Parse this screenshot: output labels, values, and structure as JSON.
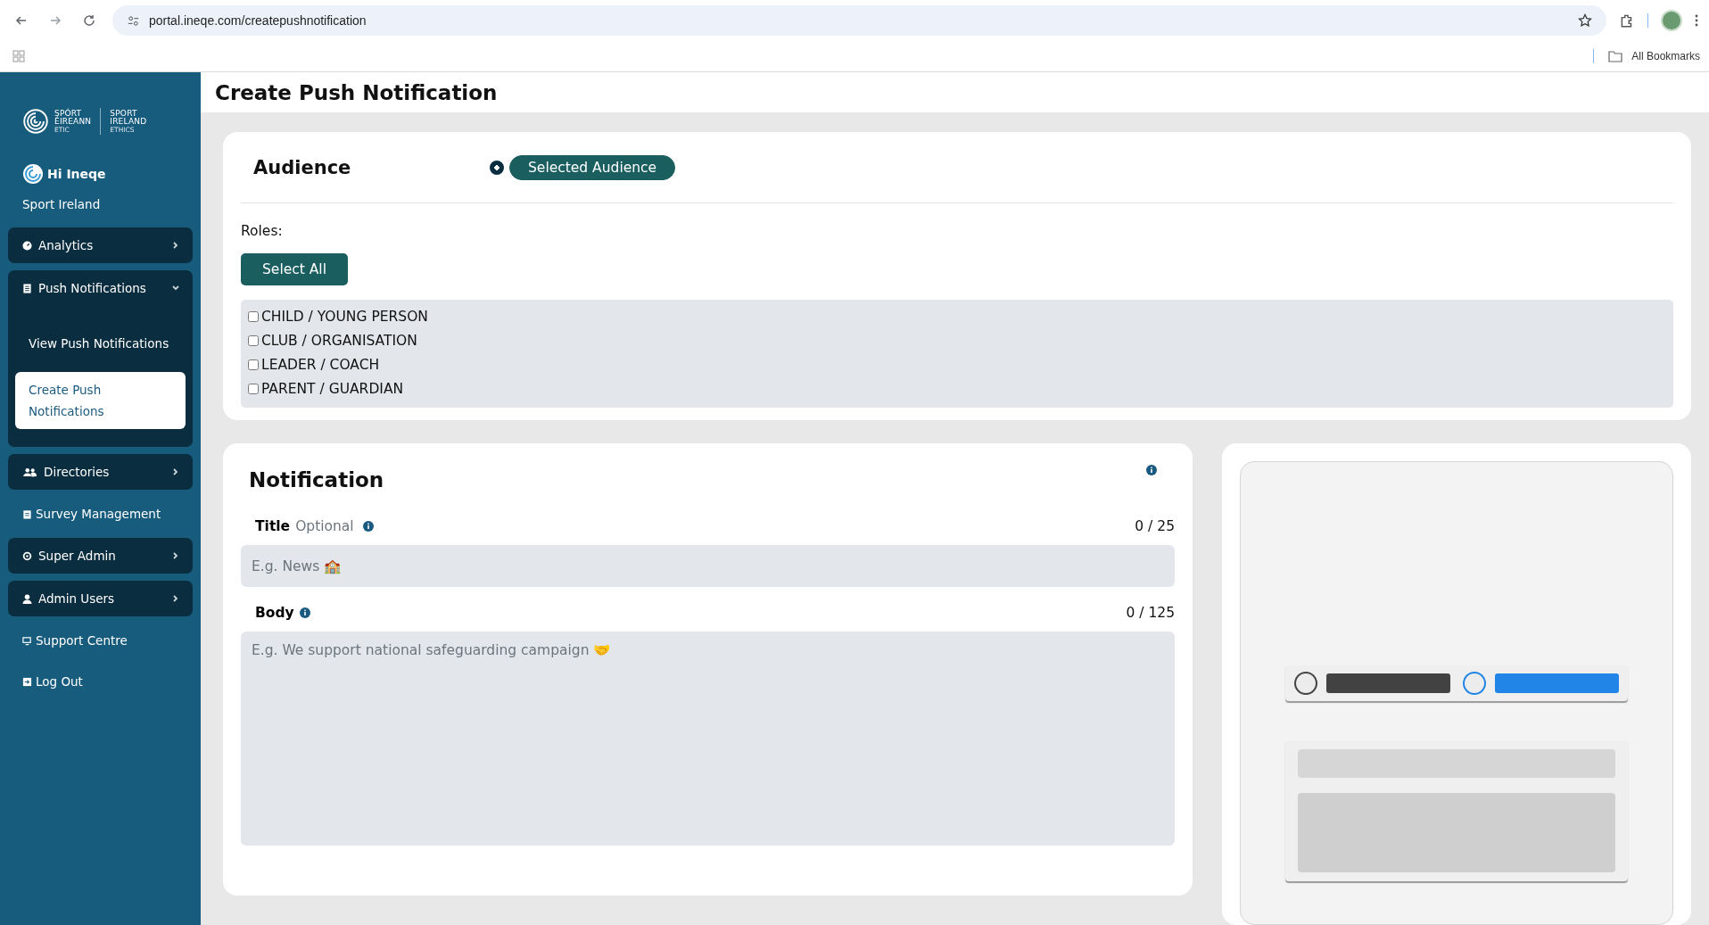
{
  "browser": {
    "url": "portal.ineqe.com/createpushnotification",
    "bookmarks_label": "All Bookmarks"
  },
  "sidebar": {
    "logo": {
      "left_line1": "SPÓRT",
      "left_line2": "ÉIREANN",
      "left_sub": "ETIC",
      "right_line1": "SPORT",
      "right_line2": "IRELAND",
      "right_sub": "ETHICS"
    },
    "greeting": "Hi Ineqe",
    "organisation": "Sport Ireland",
    "items": [
      {
        "kind": "group",
        "label": "Analytics",
        "expanded": false
      },
      {
        "kind": "group",
        "label": "Push Notifications",
        "expanded": true,
        "children": [
          {
            "label": "View Push Notifications",
            "selected": false
          },
          {
            "label": "Create Push Notifications",
            "selected": true
          }
        ]
      },
      {
        "kind": "group",
        "label": "Directories",
        "expanded": false
      },
      {
        "kind": "link",
        "label": "Survey Management"
      },
      {
        "kind": "group",
        "label": "Super Admin",
        "expanded": false
      },
      {
        "kind": "group",
        "label": "Admin Users",
        "expanded": false
      },
      {
        "kind": "link",
        "label": "Support Centre"
      },
      {
        "kind": "link",
        "label": "Log Out"
      }
    ]
  },
  "page": {
    "title": "Create Push Notification"
  },
  "audience": {
    "heading": "Audience",
    "options": [
      {
        "label": "Selected Audience",
        "selected": true
      }
    ],
    "roles_label": "Roles:",
    "select_all": "Select All",
    "roles": [
      {
        "label": "CHILD / YOUNG PERSON",
        "checked": false
      },
      {
        "label": "CLUB / ORGANISATION",
        "checked": false
      },
      {
        "label": "LEADER / COACH",
        "checked": false
      },
      {
        "label": "PARENT / GUARDIAN",
        "checked": false
      }
    ]
  },
  "notification": {
    "heading": "Notification",
    "fields": [
      {
        "kind": "input",
        "label": "Title",
        "hint": "Optional",
        "counter": "0 / 25",
        "placeholder": "E.g. News 🏫"
      },
      {
        "kind": "textarea",
        "label": "Body",
        "counter": "0 / 125",
        "placeholder": "E.g. We support national safeguarding campaign 🤝"
      }
    ]
  }
}
